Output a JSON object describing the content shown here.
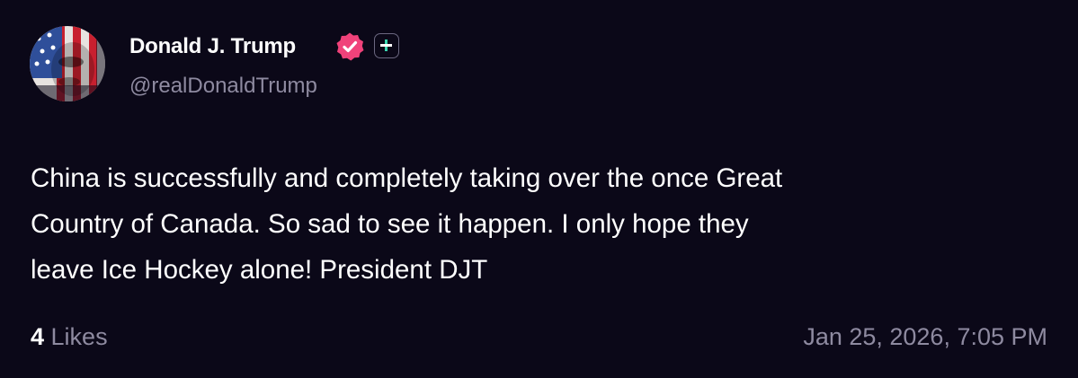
{
  "author": {
    "display_name": "Donald J. Trump",
    "handle": "@realDonaldTrump",
    "avatar": "flag-painted-portrait-avatar",
    "verified_icon": "verified-check-badge-icon",
    "verified_color": "#f0427a",
    "plus_icon": "plus-badge-icon"
  },
  "post": {
    "lines": [
      "China is successfully and completely taking over the once Great",
      "Country of Canada. So sad to see it happen. I only hope they",
      "leave Ice Hockey alone! President DJT"
    ]
  },
  "footer": {
    "likes_count": "4",
    "likes_label": " Likes",
    "timestamp": "Jan 25, 2026, 7:05 PM"
  },
  "colors": {
    "background": "#0b0818",
    "text_primary": "#ffffff",
    "text_secondary": "#8e8aa0"
  }
}
